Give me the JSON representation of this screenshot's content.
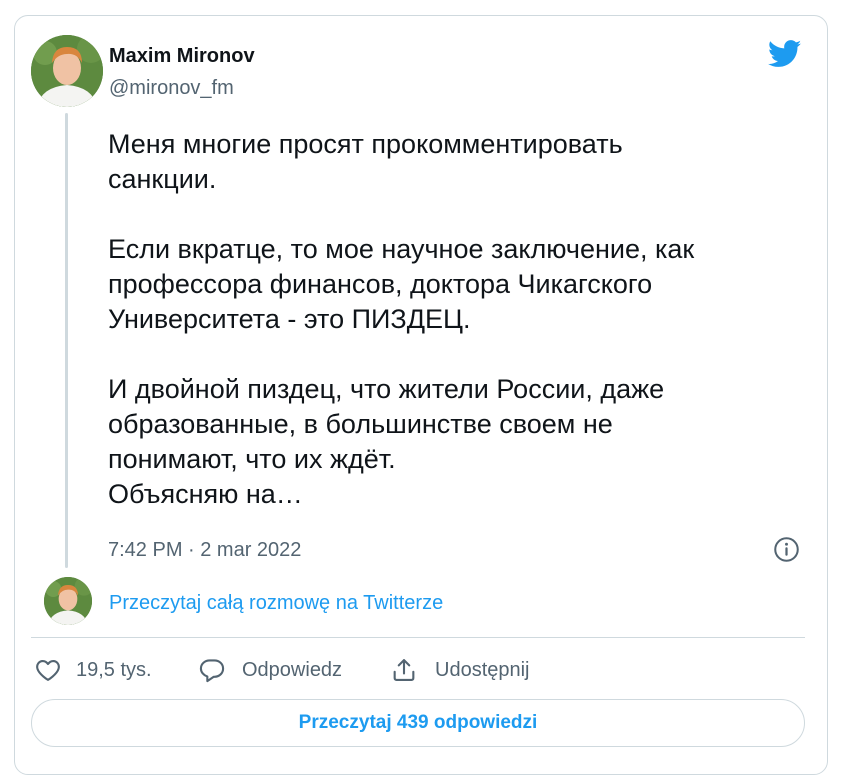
{
  "author": {
    "name": "Maxim Mironov",
    "handle": "@mironov_fm"
  },
  "tweet": {
    "paragraphs": [
      "Меня многие просят прокомментировать\nсанкции.",
      "Если вкратце, то мое научное заключение, как\nпрофессора финансов, доктора Чикагского\nУниверситета - это ПИЗДЕЦ.",
      "И двойной пиздец, что жители России, даже\nобразованные, в большинстве своем не\nпонимают, что их ждёт.\nОбъясняю на…"
    ],
    "timestamp": "7:42 PM · 2 mar 2022"
  },
  "conversation_link": "Przeczytaj całą rozmowę na Twitterze",
  "actions": {
    "like_count": "19,5 tys.",
    "reply_label": "Odpowiedz",
    "share_label": "Udostępnij"
  },
  "read_replies_label": "Przeczytaj 439 odpowiedzi",
  "colors": {
    "accent": "#1d9bf0",
    "text": "#0f1419",
    "secondary": "#536471",
    "border": "#cfd9de"
  },
  "icons": [
    "twitter-bird-icon",
    "info-icon",
    "heart-icon",
    "reply-bubble-icon",
    "share-icon"
  ]
}
